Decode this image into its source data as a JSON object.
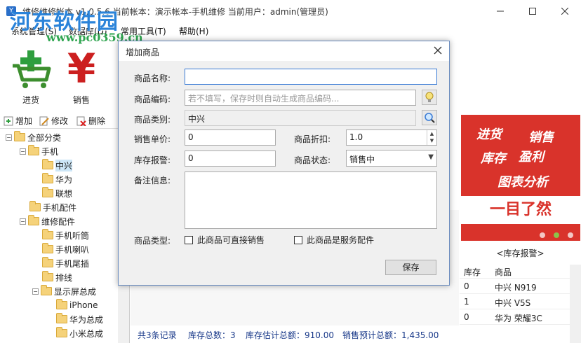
{
  "window": {
    "title": "维修维修帐本 v1.0.5.6   当前帐本：演示帐本-手机维修   当前用户：admin(管理员)",
    "watermark": "河东软件园",
    "watermark_url": "www.pc0359.cn"
  },
  "menubar": [
    "系统管理(S)",
    "数据库(D)",
    "常用工具(T)",
    "帮助(H)"
  ],
  "toolbar": {
    "purchase": "进货",
    "sales": "销售"
  },
  "left_tools": {
    "add": "增加",
    "edit": "修改",
    "delete": "删除"
  },
  "tree": [
    {
      "label": "全部分类",
      "toggle": "−"
    },
    {
      "label": "手机",
      "toggle": "−"
    },
    {
      "label": "中兴"
    },
    {
      "label": "华为"
    },
    {
      "label": "联想"
    },
    {
      "label": "手机配件"
    },
    {
      "label": "维修配件",
      "toggle": "−"
    },
    {
      "label": "手机听筒"
    },
    {
      "label": "手机喇叭"
    },
    {
      "label": "手机尾插"
    },
    {
      "label": "排线"
    },
    {
      "label": "显示屏总成",
      "toggle": "−"
    },
    {
      "label": "iPhone"
    },
    {
      "label": "华为总成"
    },
    {
      "label": "小米总成"
    }
  ],
  "dialog": {
    "title": "增加商品",
    "name_label": "商品名称:",
    "name_value": "",
    "code_label": "商品编码:",
    "code_placeholder": "若不填写，保存时则自动生成商品编码...",
    "category_label": "商品类别:",
    "category_value": "中兴",
    "price_label": "销售单价:",
    "price_value": "0",
    "discount_label": "商品折扣:",
    "discount_value": "1.0",
    "alert_label": "库存报警:",
    "alert_value": "0",
    "status_label": "商品状态:",
    "status_value": "销售中",
    "note_label": "备注信息:",
    "note_value": "",
    "type_label": "商品类型:",
    "direct_sale": "此商品可直接销售",
    "service_part": "此商品是服务配件",
    "save": "保存"
  },
  "status": {
    "records": "共3条记录",
    "stock_total": "库存总数：3",
    "stock_value": "库存估计总额：910.00",
    "sales_value": "销售预计总额：1,435.00"
  },
  "banner": {
    "l1a": "进货",
    "l1b": "销售",
    "l2a": "库存",
    "l2b": "盈利",
    "l3": "图表分析",
    "bottom": "一目了然"
  },
  "stock_alert": {
    "title": "<库存报警>",
    "headers": [
      "库存",
      "商品"
    ],
    "rows": [
      [
        "0",
        "中兴 N919"
      ],
      [
        "1",
        "中兴 V5S"
      ],
      [
        "0",
        "华为 荣耀3C"
      ]
    ]
  }
}
